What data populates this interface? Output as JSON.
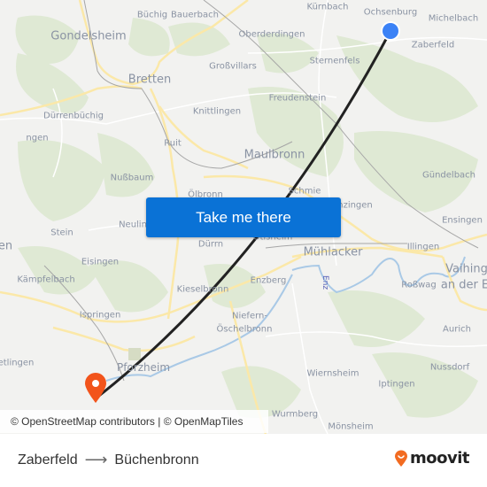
{
  "map": {
    "labels": {
      "gondelsheim": "Gondelsheim",
      "buchig": "Büchig",
      "bauerbach": "Bauerbach",
      "kurnbach": "Kürnbach",
      "ochsenburg": "Ochsenburg",
      "michelbach": "Michelbach",
      "oberderdingen": "Oberderdingen",
      "zaberfeld": "Zaberfeld",
      "grossvillars": "Großvillars",
      "sternenfels": "Sternenfels",
      "bretten": "Bretten",
      "freudenstein": "Freudenstein",
      "durrenbuchig": "Dürrenbüchig",
      "knittlingen": "Knittlingen",
      "ngen": "ngen",
      "ruit": "Ruit",
      "maulbronn": "Maulbronn",
      "gundelbach": "Gündelbach",
      "nussbaum": "Nußbaum",
      "olbronn": "Ölbronn",
      "schmie": "Schmie",
      "lienzingen": "nzingen",
      "ensingen": "Ensingen",
      "stein": "Stein",
      "neulingen": "Neulin",
      "en": "en",
      "durrn": "Dürrn",
      "otisheim": "Ötisheim",
      "muhlacker": "Mühlacker",
      "illingen": "Illingen",
      "eisingen": "Eisingen",
      "vaihingen": "Vaihing",
      "vaihingen2": "an der E",
      "kampfelbach": "Kämpfelbach",
      "enzberg": "Enzberg",
      "enz": "Enz",
      "rosswag": "Roßwag",
      "kieselbronn": "Kieselbronn",
      "ispringen": "Ispringen",
      "niefern": "Niefern-",
      "oschelbronn": "Öschelbronn",
      "aurich": "Aurich",
      "etlingen": "etlingen",
      "pforzheim": "Pforzheim",
      "nussdorf": "Nussdorf",
      "wiernsheim": "Wiernsheim",
      "iptingen": "Iptingen",
      "wurmberg": "Wurmberg",
      "monsheim": "Mönsheim"
    },
    "colors": {
      "origin_marker": "#3b82f6",
      "destination_marker": "#f2541b",
      "route_line": "#222222"
    }
  },
  "cta": {
    "label": "Take me there",
    "color": "#0a72d6"
  },
  "attribution": "© OpenStreetMap contributors | © OpenMapTiles",
  "footer": {
    "origin": "Zaberfeld",
    "arrow": "⟶",
    "destination": "Büchenbronn",
    "logo_text": "moovit",
    "logo_color": "#f26b21"
  }
}
